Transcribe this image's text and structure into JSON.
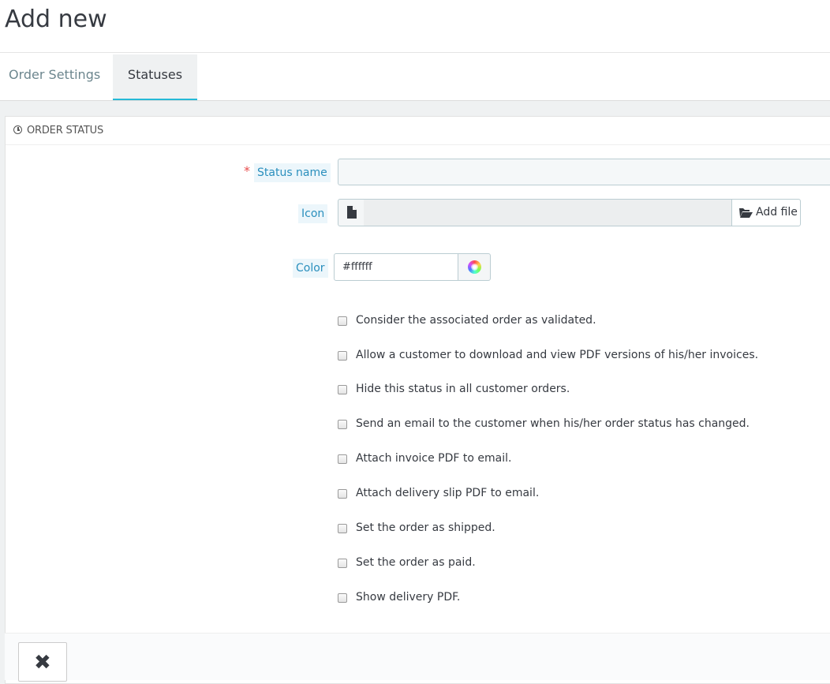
{
  "page": {
    "title": "Add new"
  },
  "tabs": [
    {
      "label": "Order Settings",
      "active": false
    },
    {
      "label": "Statuses",
      "active": true
    }
  ],
  "panel": {
    "heading": "ORDER STATUS",
    "heading_icon": "clock-icon",
    "fields": {
      "status_name": {
        "label": "Status name",
        "required_marker": "*",
        "value": ""
      },
      "icon": {
        "label": "Icon",
        "file_icon": "file-icon",
        "button_label": "Add file",
        "button_icon": "folder-open-icon",
        "value": ""
      },
      "color": {
        "label": "Color",
        "value": "#ffffff",
        "picker_icon": "color-wheel-icon"
      }
    },
    "options": [
      {
        "label": "Consider the associated order as validated.",
        "checked": false
      },
      {
        "label": "Allow a customer to download and view PDF versions of his/her invoices.",
        "checked": false
      },
      {
        "label": "Hide this status in all customer orders.",
        "checked": false
      },
      {
        "label": "Send an email to the customer when his/her order status has changed.",
        "checked": false
      },
      {
        "label": "Attach invoice PDF to email.",
        "checked": false
      },
      {
        "label": "Attach delivery slip PDF to email.",
        "checked": false
      },
      {
        "label": "Set the order as shipped.",
        "checked": false
      },
      {
        "label": "Set the order as paid.",
        "checked": false
      },
      {
        "label": "Show delivery PDF.",
        "checked": false
      }
    ]
  },
  "footer": {
    "cancel_icon": "close-icon"
  },
  "colors": {
    "accent": "#25b9d7",
    "label_text": "#2a8fbd",
    "required": "#e84e4e"
  }
}
